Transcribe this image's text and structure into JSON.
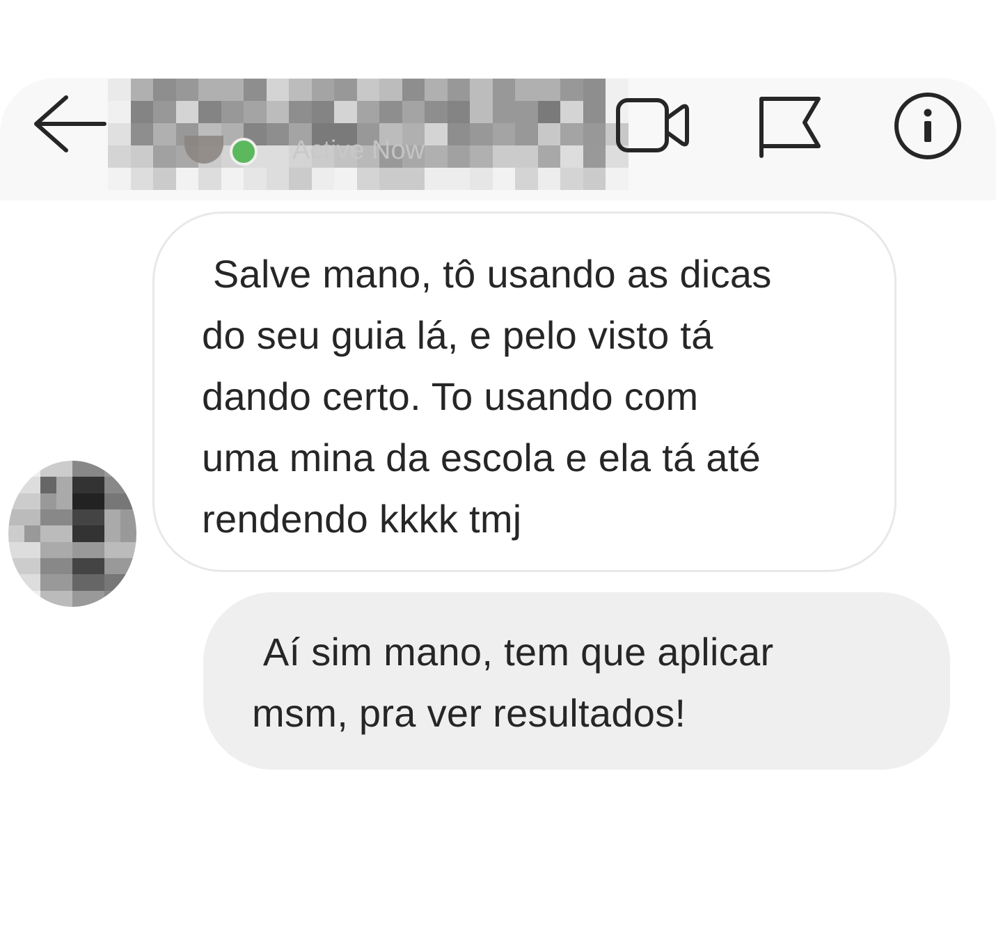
{
  "header": {
    "back_icon": "arrow-left-icon",
    "contact_name": "",
    "contact_status": "Active Now",
    "online_color": "#5cb85c",
    "actions": [
      {
        "icon": "video-camera-icon"
      },
      {
        "icon": "flag-icon"
      },
      {
        "icon": "info-icon"
      }
    ]
  },
  "messages": [
    {
      "direction": "incoming",
      "text": " Salve mano, tô usando as dicas\ndo seu guia lá, e pelo visto tá\ndando certo. To usando com\numa mina da escola e ela tá até\nrendendo kkkk tmj"
    },
    {
      "direction": "outgoing",
      "text": " Aí sim mano, tem que aplicar\nmsm, pra ver resultados!"
    }
  ],
  "colors": {
    "header_bg": "#f8f8f8",
    "incoming_bubble_border": "#e8e8e8",
    "outgoing_bubble_bg": "#efefef",
    "text": "#262626"
  }
}
